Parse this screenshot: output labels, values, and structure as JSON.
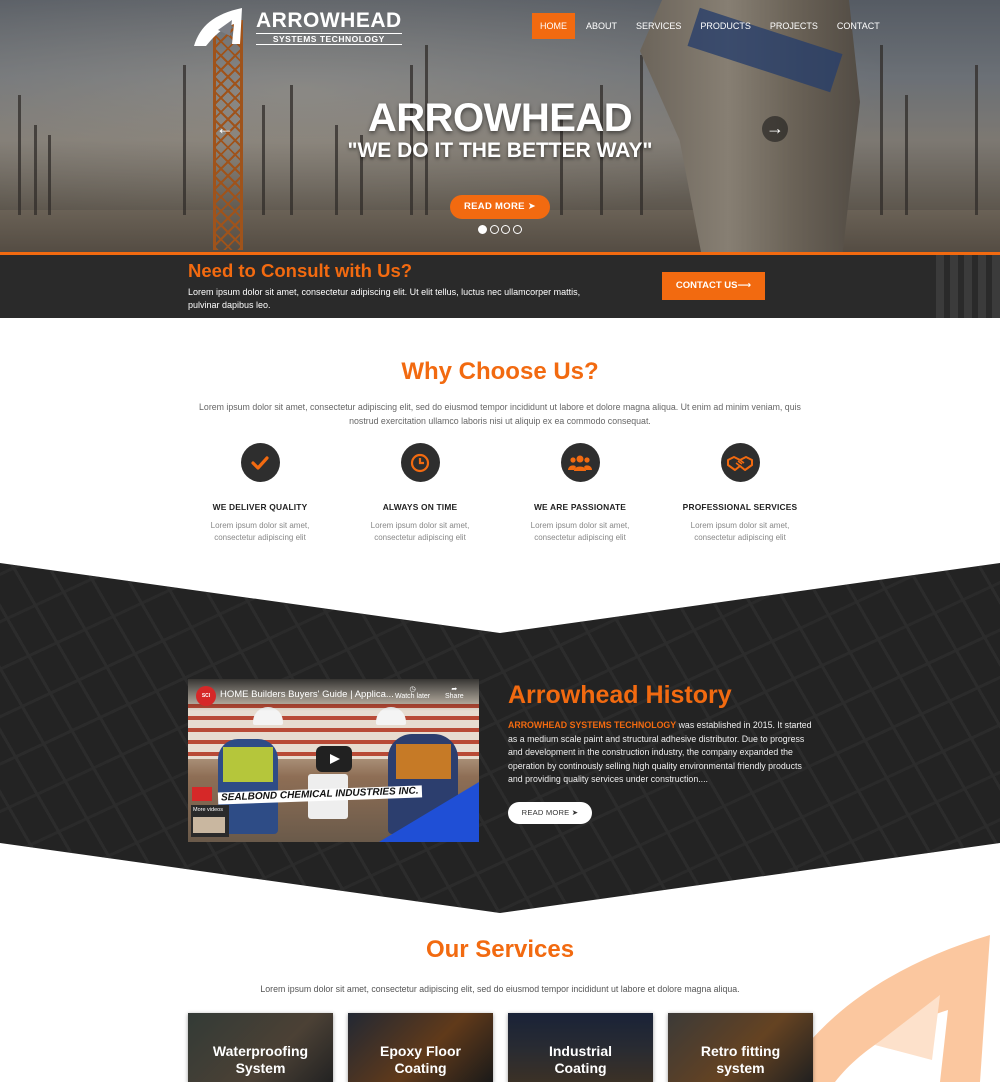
{
  "brand": {
    "name": "ARROWHEAD",
    "sub": "SYSTEMS TECHNOLOGY"
  },
  "nav": {
    "items": [
      "HOME",
      "ABOUT",
      "SERVICES",
      "PRODUCTS",
      "PROJECTS",
      "CONTACT"
    ],
    "active": "HOME"
  },
  "hero": {
    "title": "ARROWHEAD",
    "tagline": "\"WE DO IT THE BETTER WAY\"",
    "button": "READ MORE",
    "button_icon": "arrow-circle-right-icon",
    "slides": 4,
    "current_slide": 1
  },
  "consult": {
    "title": "Need to Consult with Us?",
    "text": "Lorem ipsum dolor sit amet, consectetur adipiscing elit. Ut elit tellus, luctus nec ullamcorper mattis, pulvinar dapibus leo.",
    "button": "CONTACT US",
    "button_icon": "long-arrow-right-icon"
  },
  "why": {
    "title": "Why Choose Us?",
    "intro": "Lorem ipsum dolor sit amet, consectetur adipiscing elit, sed do eiusmod tempor incididunt ut labore et dolore magna aliqua. Ut enim ad minim veniam, quis nostrud exercitation ullamco laboris nisi ut aliquip ex ea commodo consequat.",
    "features": [
      {
        "icon": "check-icon",
        "title": "WE DELIVER QUALITY",
        "text": "Lorem ipsum dolor sit amet, consectetur adipiscing elit"
      },
      {
        "icon": "clock-icon",
        "title": "ALWAYS ON TIME",
        "text": "Lorem ipsum dolor sit amet, consectetur adipiscing elit"
      },
      {
        "icon": "users-icon",
        "title": "WE ARE PASSIONATE",
        "text": "Lorem ipsum dolor sit amet, consectetur adipiscing elit"
      },
      {
        "icon": "handshake-icon",
        "title": "PROFESSIONAL SERVICES",
        "text": "Lorem ipsum dolor sit amet, consectetur adipiscing elit"
      }
    ]
  },
  "history": {
    "title": "Arrowhead History",
    "highlight": "ARROWHEAD SYSTEMS TECHNOLOGY",
    "text": " was established in 2015. It started as a medium scale paint and structural adhesive distributor. Due to progress and development in the construction industry, the company expanded the operation by continously selling high quality environmental friendly products and providing quality services under construction....",
    "button": "READ MORE",
    "video": {
      "title": "HOME Builders Buyers' Guide | Applica...",
      "watch_later": "Watch later",
      "share": "Share",
      "watermark": "SEALBOND CHEMICAL INDUSTRIES INC.",
      "more_videos": "More videos"
    }
  },
  "services": {
    "title": "Our Services",
    "intro": "Lorem ipsum dolor sit amet, consectetur adipiscing elit, sed do eiusmod tempor incididunt ut labore et dolore magna aliqua.",
    "cards": [
      {
        "line1": "Waterproofing",
        "line2": "System"
      },
      {
        "line1": "Epoxy Floor",
        "line2": "Coating"
      },
      {
        "line1": "Industrial",
        "line2": "Coating"
      },
      {
        "line1": "Retro fitting",
        "line2": "system"
      }
    ]
  },
  "colors": {
    "accent": "#f26a10",
    "dark": "#2a2a2a",
    "text": "#333333"
  }
}
